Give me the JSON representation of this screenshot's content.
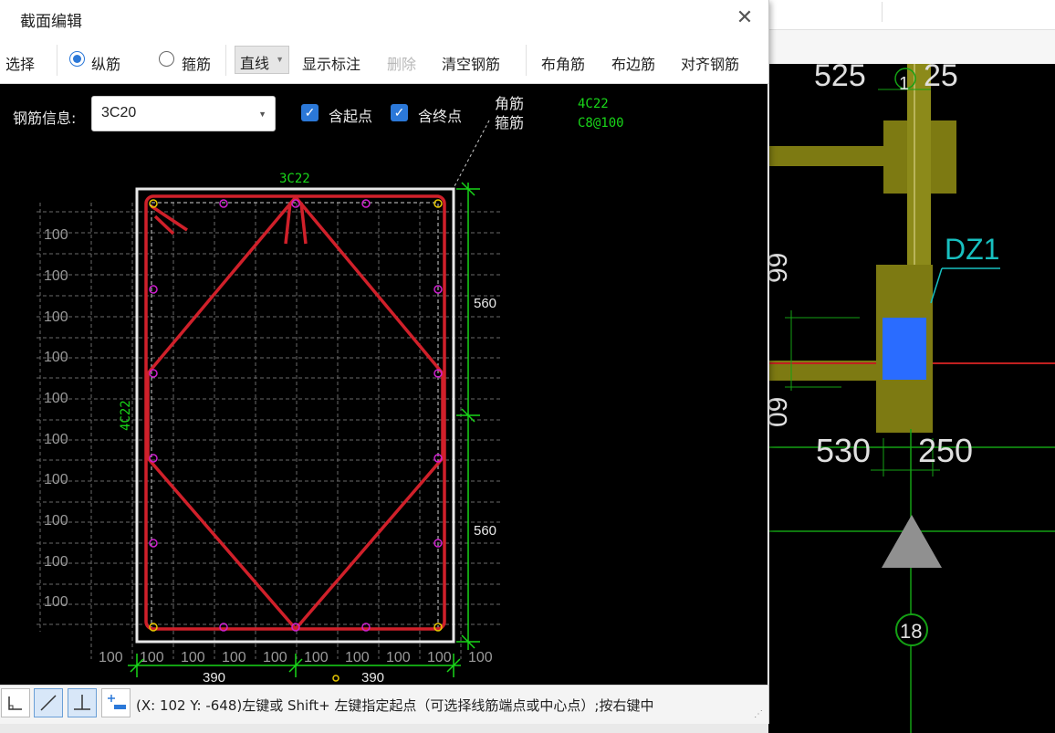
{
  "dialog": {
    "title": "截面编辑",
    "close_glyph": "✕",
    "toolbar": {
      "select": "选择",
      "longitudinal": "纵筋",
      "stirrup": "箍筋",
      "line_mode": "直线",
      "show_labels": "显示标注",
      "delete": "删除",
      "clear_rebar": "清空钢筋",
      "corner_rebar": "布角筋",
      "side_rebar": "布边筋",
      "align_rebar": "对齐钢筋",
      "selected_radio": "longitudinal"
    },
    "rebar_info": {
      "label": "钢筋信息:",
      "value": "3C20",
      "include_start_label": "含起点",
      "include_start": true,
      "include_end_label": "含终点",
      "include_end": true
    },
    "drawing": {
      "legend_corner_label": "角筋",
      "legend_stirrup_label": "箍筋",
      "corner_value": "4C22",
      "stirrup_value": "C8@100",
      "top_rebar": "3C22",
      "side_rebar": "4C22",
      "dim_right_1": "560",
      "dim_right_2": "560",
      "dim_bottom_1": "390",
      "dim_bottom_2": "390",
      "grid_spacing_label": "100"
    },
    "status": {
      "text": "(X: 102 Y: -648)左键或 Shift+ 左键指定起点（可选择线筋端点或中心点）;按右键中"
    }
  },
  "background_cad": {
    "dim_top": "525",
    "dim_top_right": "25",
    "axis_top": "1",
    "column_label": "DZ1",
    "dim_left_1": "530",
    "dim_left_2": "250",
    "side_dim_1": "99",
    "side_dim_2": "09",
    "axis_number": "18"
  },
  "colors": {
    "rebar_red": "#d0202a",
    "dim_green": "#19d619",
    "node_magenta": "#d020d0",
    "node_yellow": "#e8c800",
    "column_olive": "#7d7a12",
    "column_blue": "#2a6cff"
  }
}
